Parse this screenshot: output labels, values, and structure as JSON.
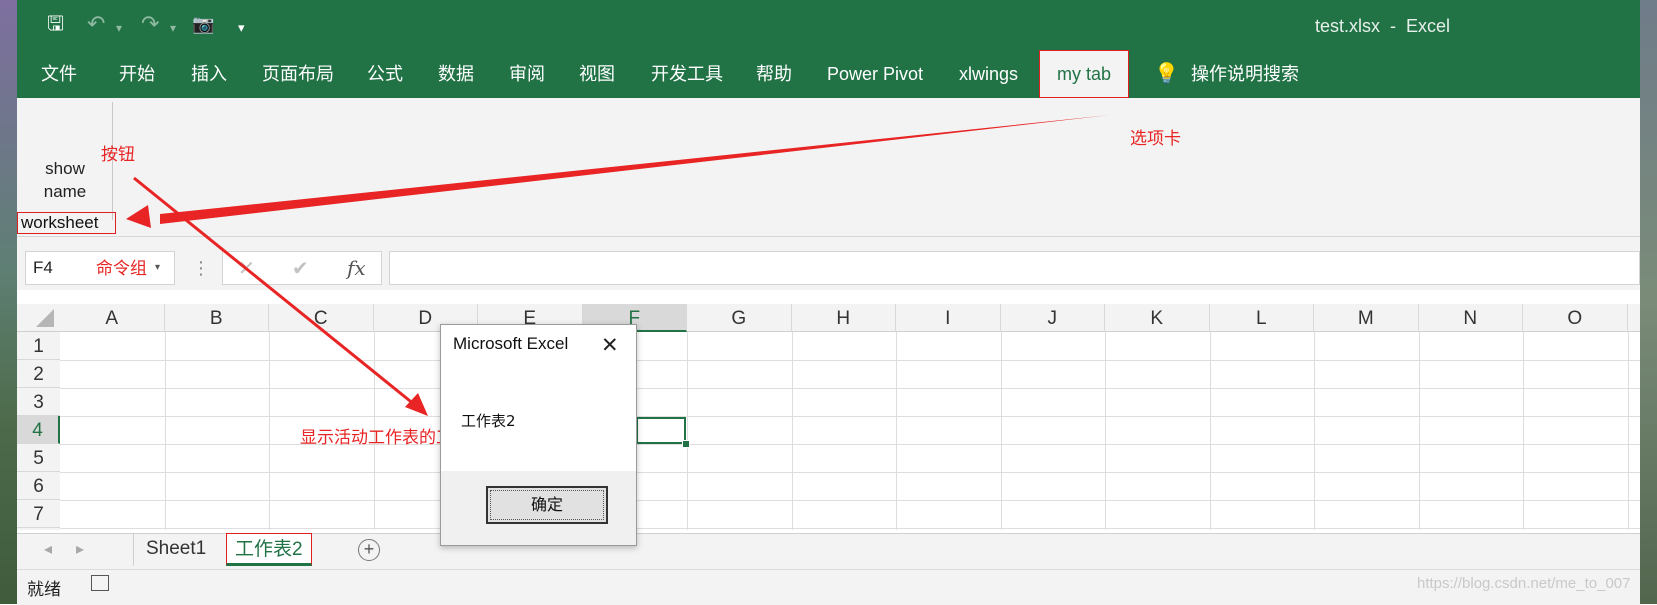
{
  "window": {
    "title": "test.xlsx  -  Excel"
  },
  "quick_access": {
    "icons": [
      "save-icon",
      "undo-icon",
      "redo-icon",
      "camera-icon",
      "customize-icon"
    ],
    "save_glyph": "🖫",
    "undo_glyph": "↶",
    "redo_glyph": "↷",
    "camera_glyph": "📷",
    "customize_glyph": "▾",
    "dropdown_glyph": "▾"
  },
  "ribbon_tabs": [
    "文件",
    "开始",
    "插入",
    "页面布局",
    "公式",
    "数据",
    "审阅",
    "视图",
    "开发工具",
    "帮助",
    "Power Pivot",
    "xlwings",
    "my tab",
    "操作说明搜索"
  ],
  "active_tab": "my tab",
  "ribbon": {
    "button_label": "show\nname",
    "group_label": "worksheet"
  },
  "annotations": {
    "button": "按钮",
    "tab": "选项卡",
    "group": "命令组",
    "action": "显示活动工作表的工作表名称"
  },
  "formula_bar": {
    "name_box": "F4",
    "cancel_glyph": "✕",
    "enter_glyph": "✔",
    "fx_label": "fx",
    "formula": ""
  },
  "grid": {
    "columns": [
      "A",
      "B",
      "C",
      "D",
      "E",
      "F",
      "G",
      "H",
      "I",
      "J",
      "K",
      "L",
      "M",
      "N",
      "O"
    ],
    "rows": [
      "1",
      "2",
      "3",
      "4",
      "5",
      "6",
      "7"
    ],
    "selected_column": "F",
    "selected_row": "4"
  },
  "sheets": {
    "tabs": [
      "Sheet1",
      "工作表2"
    ],
    "active": "工作表2",
    "add_glyph": "+",
    "prev_glyph": "◂",
    "next_glyph": "▸"
  },
  "status": {
    "text": "就绪",
    "watermark": "https://blog.csdn.net/me_to_007"
  },
  "dialog": {
    "title": "Microsoft Excel",
    "close_glyph": "✕",
    "message": "工作表2",
    "ok_label": "确定"
  },
  "colors": {
    "excel_green": "#217346",
    "annotation_red": "#e82424",
    "ribbon_bg": "#f3f3f3"
  }
}
